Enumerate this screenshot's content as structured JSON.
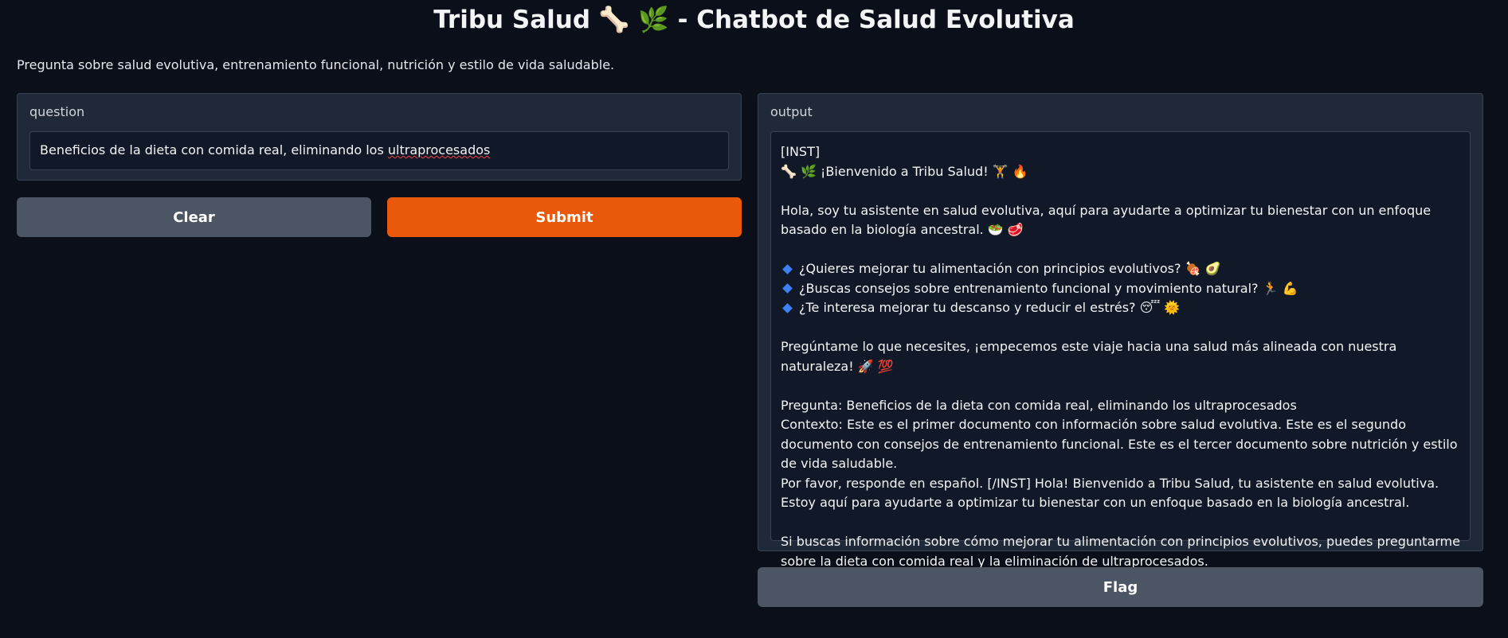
{
  "app": {
    "title": "Tribu Salud 🦴 🌿 - Chatbot de Salud Evolutiva",
    "description": "Pregunta sobre salud evolutiva, entrenamiento funcional, nutrición y estilo de vida saludable."
  },
  "input": {
    "label": "question",
    "value_start": "Beneficios de la dieta con comida real, eliminando los ",
    "value_misspelled": "ultraprocesados"
  },
  "buttons": {
    "clear": "Clear",
    "submit": "Submit",
    "flag": "Flag"
  },
  "output": {
    "label": "output",
    "lines": {
      "inst": "[INST]",
      "welcome": "🦴 🌿 ¡Bienvenido a Tribu Salud! 🏋️ 🔥",
      "intro": "Hola, soy tu asistente en salud evolutiva, aquí para ayudarte a optimizar tu bienestar con un enfoque basado en la biología ancestral. 🥗 🥩",
      "bullet_1": "¿Quieres mejorar tu alimentación con principios evolutivos? 🍖 🥑",
      "bullet_2": "¿Buscas consejos sobre entrenamiento funcional y movimiento natural? 🏃 💪",
      "bullet_3": "¿Te interesa mejorar tu descanso y reducir el estrés? 😴 🌞",
      "invite": "Pregúntame lo que necesites, ¡empecemos este viaje hacia una salud más alineada con nuestra naturaleza! 🚀 💯",
      "question": "Pregunta: Beneficios de la dieta con comida real, eliminando los ultraprocesados",
      "context": "Contexto: Este es el primer documento con información sobre salud evolutiva. Este es el segundo documento con consejos de entrenamiento funcional. Este es el tercer documento sobre nutrición y estilo de vida saludable.",
      "answer": "Por favor, responde en español. [/INST] Hola! Bienvenido a Tribu Salud, tu asistente en salud evolutiva. Estoy aquí para ayudarte a optimizar tu bienestar con un enfoque basado en la biología ancestral.",
      "followup": "Si buscas información sobre cómo mejorar tu alimentación con principios evolutivos, puedes preguntarme sobre la dieta con comida real y la eliminación de ultraprocesados."
    }
  },
  "colors": {
    "background": "#0b0f19",
    "panel": "#1f2937",
    "primary_button": "#ea580c",
    "secondary_button": "#4b5563",
    "bullet": "#3b82f6"
  },
  "icons": {
    "bullet": "small-blue-diamond-icon"
  }
}
